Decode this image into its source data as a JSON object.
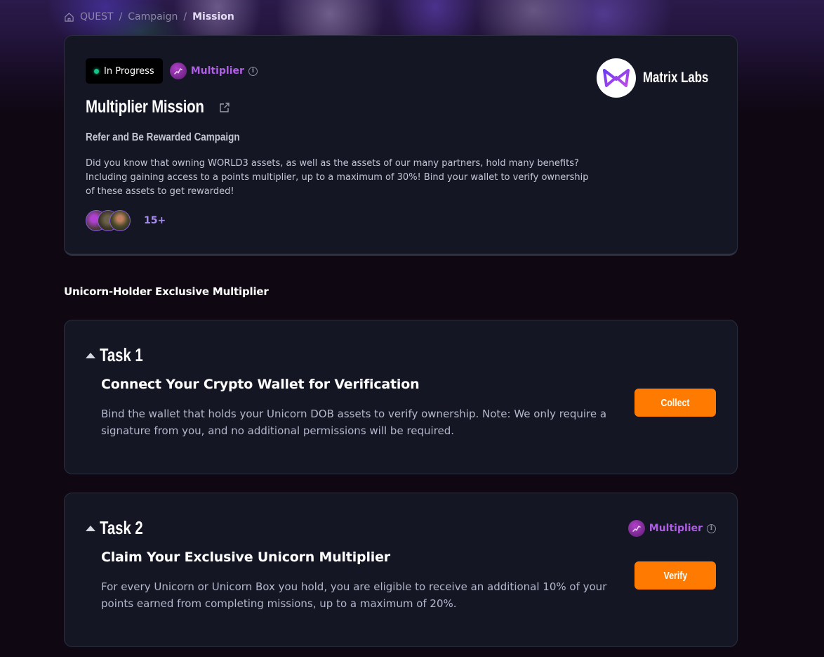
{
  "breadcrumb": {
    "items": [
      "QUEST",
      "Campaign",
      "Mission"
    ],
    "separator": "/"
  },
  "mission": {
    "status": "In Progress",
    "badge_label": "Multiplier",
    "info_glyph": "i",
    "title": "Multiplier Mission",
    "subtitle": "Refer and Be Rewarded Campaign",
    "description": "Did you know that owning WORLD3 assets, as well as the assets of our many partners, hold many benefits? Including gaining access to a points multiplier, up to a maximum of 30%! Bind your wallet to verify ownership of these assets to get rewarded!",
    "participants_count": "15+",
    "partner_name": "Matrix Labs"
  },
  "section": {
    "title": "Unicorn-Holder Exclusive Multiplier"
  },
  "tasks": [
    {
      "label": "Task 1",
      "title": "Connect Your Crypto Wallet for Verification",
      "description": "Bind the wallet that holds your Unicorn DOB assets to verify ownership. Note: We only require a signature from you, and no additional permissions will be required.",
      "button": "Collect"
    },
    {
      "label": "Task 2",
      "badge_label": "Multiplier",
      "title": "Claim Your Exclusive Unicorn Multiplier",
      "description": "For every Unicorn or Unicorn Box you hold, you are eligible to receive an additional 10% of your points earned from completing missions, up to a maximum of 20%.",
      "button": "Verify"
    }
  ],
  "colors": {
    "accent_orange": "#ff7a00",
    "multiplier_purple": "#b05ee6",
    "status_green": "#18c28a",
    "card_bg": "#141624",
    "page_bg": "#0f0813"
  },
  "icons": {
    "home": "home-icon",
    "external": "external-link-icon",
    "info": "info-icon",
    "multiplier": "multiplier-chart-icon",
    "caret": "caret-up-icon",
    "partner_logo": "matrix-labs-logo"
  }
}
